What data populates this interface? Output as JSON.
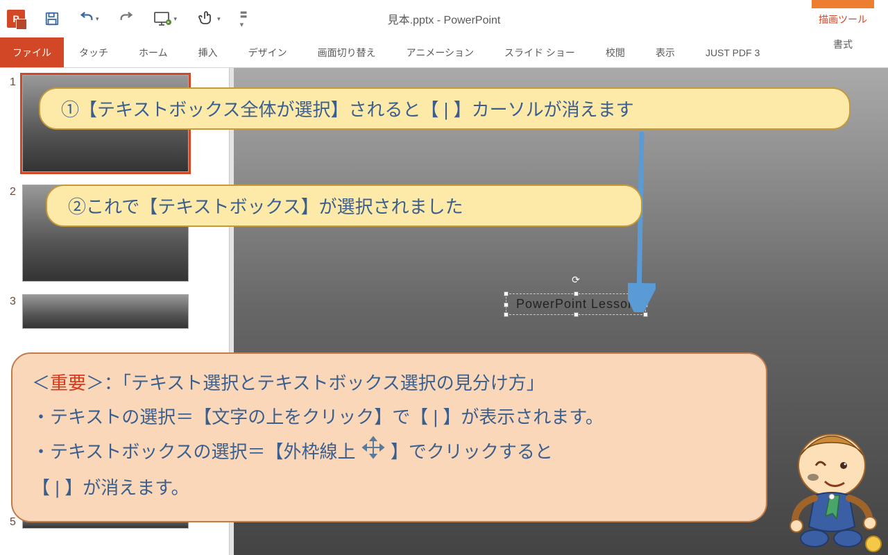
{
  "title": "見本.pptx - PowerPoint",
  "tool_tab": "描画ツール",
  "ribbon": {
    "file": "ファイル",
    "touch": "タッチ",
    "home": "ホーム",
    "insert": "挿入",
    "design": "デザイン",
    "transition": "画面切り替え",
    "animation": "アニメーション",
    "slideshow": "スライド ショー",
    "review": "校閲",
    "view": "表示",
    "justpdf": "JUST PDF 3",
    "format": "書式"
  },
  "thumbs": {
    "n1": "1",
    "n2": "2",
    "n3": "3",
    "n5": "5"
  },
  "textbox": "PowerPoint  Lesson",
  "callout1": "①【テキストボックス全体が選択】されると【 | 】カーソルが消えます",
  "callout2": "②これで【テキストボックス】が選択されました",
  "important": {
    "prefix": "＜",
    "label": "重要",
    "suffix": "＞：「テキスト選択とテキストボックス選択の見分け方」",
    "line1": "・テキストの選択＝【文字の上をクリック】で【 | 】が表示されます。",
    "line2a": "・テキストボックスの選択＝【外枠線上",
    "line2b": "】でクリックすると",
    "line3": "【 | 】が消えます。"
  }
}
